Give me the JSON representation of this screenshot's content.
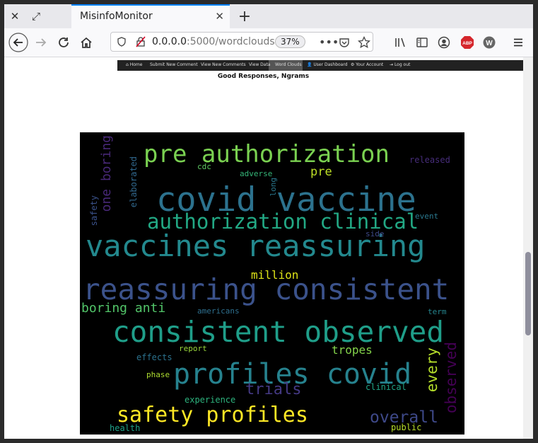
{
  "browser": {
    "tab_title": "MisinfoMonitor",
    "url_host": "0.0.0.0",
    "url_path": ":5000/wordclouds",
    "zoom": "37%",
    "adblock_badge": "ABP",
    "ext_badge": "W"
  },
  "site_nav": {
    "home": "Home",
    "submit": "Submit New Comment",
    "view_new": "View New Comments",
    "view_data": "View Data",
    "word_clouds": "Word Clouds",
    "dashboard": "User Dashboard",
    "account": "Your Account",
    "logout": "Log out"
  },
  "page": {
    "title": "Good Responses, Ngrams"
  },
  "wordcloud": {
    "words": [
      {
        "text": "pre authorization",
        "color": "#7ad151"
      },
      {
        "text": "covid vaccine",
        "color": "#2c728e"
      },
      {
        "text": "authorization clinical",
        "color": "#22a884"
      },
      {
        "text": "vaccines reassuring",
        "color": "#23898e"
      },
      {
        "text": "reassuring consistent",
        "color": "#3b528b"
      },
      {
        "text": "consistent observed",
        "color": "#1f9e89"
      },
      {
        "text": "profiles covid",
        "color": "#26828e"
      },
      {
        "text": "safety profiles",
        "color": "#fde725"
      },
      {
        "text": "trials",
        "color": "#443983"
      },
      {
        "text": "overall",
        "color": "#3e4989"
      },
      {
        "text": "every",
        "color": "#b5de2b"
      },
      {
        "text": "observed",
        "color": "#440154"
      },
      {
        "text": "one boring",
        "color": "#482878"
      },
      {
        "text": "elaborated",
        "color": "#31688e"
      },
      {
        "text": "safety",
        "color": "#3b528b"
      },
      {
        "text": "long",
        "color": "#2a788e"
      },
      {
        "text": "cdc",
        "color": "#5ec962"
      },
      {
        "text": "adverse",
        "color": "#35b779"
      },
      {
        "text": "pre",
        "color": "#bddf26"
      },
      {
        "text": "released",
        "color": "#472d7b"
      },
      {
        "text": "event",
        "color": "#2a788e"
      },
      {
        "text": "side",
        "color": "#3e4a89"
      },
      {
        "text": "million",
        "color": "#dde318"
      },
      {
        "text": "boring anti",
        "color": "#52c569"
      },
      {
        "text": "americans",
        "color": "#2e6f8e"
      },
      {
        "text": "term",
        "color": "#25858e"
      },
      {
        "text": "effects",
        "color": "#2c728e"
      },
      {
        "text": "report",
        "color": "#9bd93c"
      },
      {
        "text": "tropes",
        "color": "#84d44b"
      },
      {
        "text": "phase",
        "color": "#addc30"
      },
      {
        "text": "clinical",
        "color": "#20a386"
      },
      {
        "text": "experience",
        "color": "#2db27d"
      },
      {
        "text": "health",
        "color": "#1fa187"
      },
      {
        "text": "public",
        "color": "#b8de29"
      }
    ]
  }
}
